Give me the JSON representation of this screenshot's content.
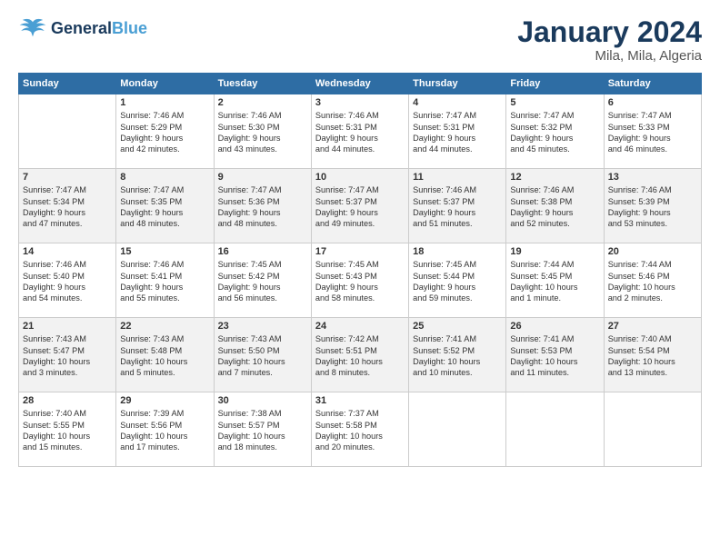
{
  "header": {
    "logo_name": "General",
    "logo_accent": "Blue",
    "title": "January 2024",
    "subtitle": "Mila, Mila, Algeria"
  },
  "calendar": {
    "days_of_week": [
      "Sunday",
      "Monday",
      "Tuesday",
      "Wednesday",
      "Thursday",
      "Friday",
      "Saturday"
    ],
    "weeks": [
      [
        {
          "day": "",
          "info": ""
        },
        {
          "day": "1",
          "info": "Sunrise: 7:46 AM\nSunset: 5:29 PM\nDaylight: 9 hours\nand 42 minutes."
        },
        {
          "day": "2",
          "info": "Sunrise: 7:46 AM\nSunset: 5:30 PM\nDaylight: 9 hours\nand 43 minutes."
        },
        {
          "day": "3",
          "info": "Sunrise: 7:46 AM\nSunset: 5:31 PM\nDaylight: 9 hours\nand 44 minutes."
        },
        {
          "day": "4",
          "info": "Sunrise: 7:47 AM\nSunset: 5:31 PM\nDaylight: 9 hours\nand 44 minutes."
        },
        {
          "day": "5",
          "info": "Sunrise: 7:47 AM\nSunset: 5:32 PM\nDaylight: 9 hours\nand 45 minutes."
        },
        {
          "day": "6",
          "info": "Sunrise: 7:47 AM\nSunset: 5:33 PM\nDaylight: 9 hours\nand 46 minutes."
        }
      ],
      [
        {
          "day": "7",
          "info": "Sunrise: 7:47 AM\nSunset: 5:34 PM\nDaylight: 9 hours\nand 47 minutes."
        },
        {
          "day": "8",
          "info": "Sunrise: 7:47 AM\nSunset: 5:35 PM\nDaylight: 9 hours\nand 48 minutes."
        },
        {
          "day": "9",
          "info": "Sunrise: 7:47 AM\nSunset: 5:36 PM\nDaylight: 9 hours\nand 48 minutes."
        },
        {
          "day": "10",
          "info": "Sunrise: 7:47 AM\nSunset: 5:37 PM\nDaylight: 9 hours\nand 49 minutes."
        },
        {
          "day": "11",
          "info": "Sunrise: 7:46 AM\nSunset: 5:37 PM\nDaylight: 9 hours\nand 51 minutes."
        },
        {
          "day": "12",
          "info": "Sunrise: 7:46 AM\nSunset: 5:38 PM\nDaylight: 9 hours\nand 52 minutes."
        },
        {
          "day": "13",
          "info": "Sunrise: 7:46 AM\nSunset: 5:39 PM\nDaylight: 9 hours\nand 53 minutes."
        }
      ],
      [
        {
          "day": "14",
          "info": "Sunrise: 7:46 AM\nSunset: 5:40 PM\nDaylight: 9 hours\nand 54 minutes."
        },
        {
          "day": "15",
          "info": "Sunrise: 7:46 AM\nSunset: 5:41 PM\nDaylight: 9 hours\nand 55 minutes."
        },
        {
          "day": "16",
          "info": "Sunrise: 7:45 AM\nSunset: 5:42 PM\nDaylight: 9 hours\nand 56 minutes."
        },
        {
          "day": "17",
          "info": "Sunrise: 7:45 AM\nSunset: 5:43 PM\nDaylight: 9 hours\nand 58 minutes."
        },
        {
          "day": "18",
          "info": "Sunrise: 7:45 AM\nSunset: 5:44 PM\nDaylight: 9 hours\nand 59 minutes."
        },
        {
          "day": "19",
          "info": "Sunrise: 7:44 AM\nSunset: 5:45 PM\nDaylight: 10 hours\nand 1 minute."
        },
        {
          "day": "20",
          "info": "Sunrise: 7:44 AM\nSunset: 5:46 PM\nDaylight: 10 hours\nand 2 minutes."
        }
      ],
      [
        {
          "day": "21",
          "info": "Sunrise: 7:43 AM\nSunset: 5:47 PM\nDaylight: 10 hours\nand 3 minutes."
        },
        {
          "day": "22",
          "info": "Sunrise: 7:43 AM\nSunset: 5:48 PM\nDaylight: 10 hours\nand 5 minutes."
        },
        {
          "day": "23",
          "info": "Sunrise: 7:43 AM\nSunset: 5:50 PM\nDaylight: 10 hours\nand 7 minutes."
        },
        {
          "day": "24",
          "info": "Sunrise: 7:42 AM\nSunset: 5:51 PM\nDaylight: 10 hours\nand 8 minutes."
        },
        {
          "day": "25",
          "info": "Sunrise: 7:41 AM\nSunset: 5:52 PM\nDaylight: 10 hours\nand 10 minutes."
        },
        {
          "day": "26",
          "info": "Sunrise: 7:41 AM\nSunset: 5:53 PM\nDaylight: 10 hours\nand 11 minutes."
        },
        {
          "day": "27",
          "info": "Sunrise: 7:40 AM\nSunset: 5:54 PM\nDaylight: 10 hours\nand 13 minutes."
        }
      ],
      [
        {
          "day": "28",
          "info": "Sunrise: 7:40 AM\nSunset: 5:55 PM\nDaylight: 10 hours\nand 15 minutes."
        },
        {
          "day": "29",
          "info": "Sunrise: 7:39 AM\nSunset: 5:56 PM\nDaylight: 10 hours\nand 17 minutes."
        },
        {
          "day": "30",
          "info": "Sunrise: 7:38 AM\nSunset: 5:57 PM\nDaylight: 10 hours\nand 18 minutes."
        },
        {
          "day": "31",
          "info": "Sunrise: 7:37 AM\nSunset: 5:58 PM\nDaylight: 10 hours\nand 20 minutes."
        },
        {
          "day": "",
          "info": ""
        },
        {
          "day": "",
          "info": ""
        },
        {
          "day": "",
          "info": ""
        }
      ]
    ]
  }
}
